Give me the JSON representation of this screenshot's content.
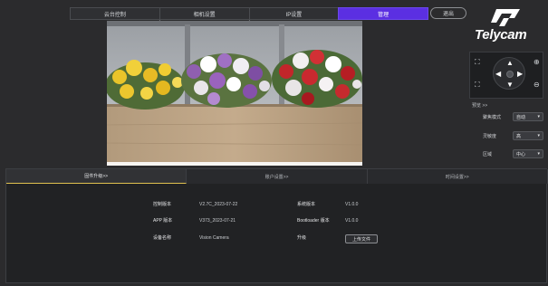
{
  "nav": {
    "tabs": [
      {
        "label": "云台控制"
      },
      {
        "label": "相机设置"
      },
      {
        "label": "IP设置"
      },
      {
        "label": "管理"
      }
    ],
    "active_index": 3,
    "exit_label": "退出"
  },
  "logo": {
    "text": "Telycam"
  },
  "ptz": {
    "icons": [
      "expand-icon",
      "zoom-in-icon",
      "collapse-icon",
      "zoom-out-icon",
      "arrow-up-icon",
      "arrow-down-icon",
      "arrow-left-icon",
      "arrow-right-icon",
      "home-icon"
    ]
  },
  "side": {
    "header": "预览 >>",
    "rows": [
      {
        "label": "聚焦模式",
        "value": "自动"
      },
      {
        "label": "灵敏度",
        "value": "高"
      },
      {
        "label": "区域",
        "value": "中心"
      }
    ]
  },
  "bottom": {
    "tabs": [
      {
        "label": "固件升级>>"
      },
      {
        "label": "账户设置>>"
      },
      {
        "label": "时间设置>>"
      }
    ],
    "active_index": 0,
    "info_left": [
      {
        "key": "控制版本",
        "value": "V2.7C_2023-07-22"
      },
      {
        "key": "APP 版本",
        "value": "V373_2023-07-21"
      },
      {
        "key": "设备名称",
        "value": "Vision Camera"
      }
    ],
    "info_right": [
      {
        "key": "系统版本",
        "value": "V1.0.0"
      },
      {
        "key": "Bootloader 版本",
        "value": "V1.0.0"
      },
      {
        "key": "升级",
        "value": ""
      }
    ],
    "upload_label": "上传文件"
  },
  "colors": {
    "accent": "#5b2fe2",
    "tab_underline": "#e0c14f"
  }
}
